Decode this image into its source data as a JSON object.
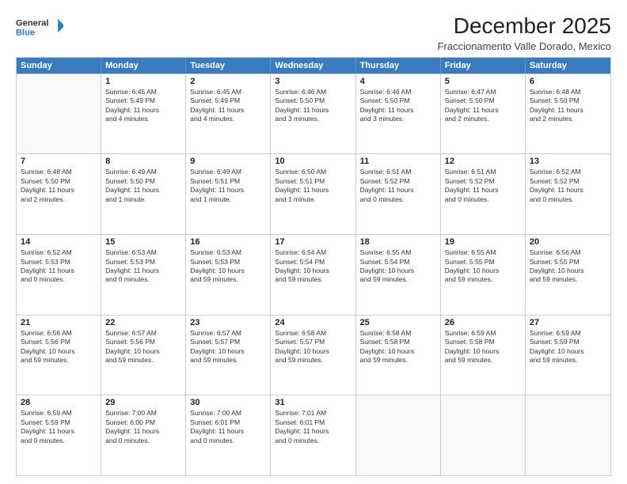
{
  "logo": {
    "line1": "General",
    "line2": "Blue"
  },
  "title": "December 2025",
  "subtitle": "Fraccionamento Valle Dorado, Mexico",
  "header": [
    "Sunday",
    "Monday",
    "Tuesday",
    "Wednesday",
    "Thursday",
    "Friday",
    "Saturday"
  ],
  "weeks": [
    [
      {
        "day": "",
        "info": ""
      },
      {
        "day": "1",
        "info": "Sunrise: 6:45 AM\nSunset: 5:49 PM\nDaylight: 11 hours\nand 4 minutes."
      },
      {
        "day": "2",
        "info": "Sunrise: 6:45 AM\nSunset: 5:49 PM\nDaylight: 11 hours\nand 4 minutes."
      },
      {
        "day": "3",
        "info": "Sunrise: 6:46 AM\nSunset: 5:50 PM\nDaylight: 11 hours\nand 3 minutes."
      },
      {
        "day": "4",
        "info": "Sunrise: 6:46 AM\nSunset: 5:50 PM\nDaylight: 11 hours\nand 3 minutes."
      },
      {
        "day": "5",
        "info": "Sunrise: 6:47 AM\nSunset: 5:50 PM\nDaylight: 11 hours\nand 2 minutes."
      },
      {
        "day": "6",
        "info": "Sunrise: 6:48 AM\nSunset: 5:50 PM\nDaylight: 11 hours\nand 2 minutes."
      }
    ],
    [
      {
        "day": "7",
        "info": "Sunrise: 6:48 AM\nSunset: 5:50 PM\nDaylight: 11 hours\nand 2 minutes."
      },
      {
        "day": "8",
        "info": "Sunrise: 6:49 AM\nSunset: 5:50 PM\nDaylight: 11 hours\nand 1 minute."
      },
      {
        "day": "9",
        "info": "Sunrise: 6:49 AM\nSunset: 5:51 PM\nDaylight: 11 hours\nand 1 minute."
      },
      {
        "day": "10",
        "info": "Sunrise: 6:50 AM\nSunset: 5:51 PM\nDaylight: 11 hours\nand 1 minute."
      },
      {
        "day": "11",
        "info": "Sunrise: 6:51 AM\nSunset: 5:52 PM\nDaylight: 11 hours\nand 0 minutes."
      },
      {
        "day": "12",
        "info": "Sunrise: 6:51 AM\nSunset: 5:52 PM\nDaylight: 11 hours\nand 0 minutes."
      },
      {
        "day": "13",
        "info": "Sunrise: 6:52 AM\nSunset: 5:52 PM\nDaylight: 11 hours\nand 0 minutes."
      }
    ],
    [
      {
        "day": "14",
        "info": "Sunrise: 6:52 AM\nSunset: 5:53 PM\nDaylight: 11 hours\nand 0 minutes."
      },
      {
        "day": "15",
        "info": "Sunrise: 6:53 AM\nSunset: 5:53 PM\nDaylight: 11 hours\nand 0 minutes."
      },
      {
        "day": "16",
        "info": "Sunrise: 6:53 AM\nSunset: 5:53 PM\nDaylight: 10 hours\nand 59 minutes."
      },
      {
        "day": "17",
        "info": "Sunrise: 6:54 AM\nSunset: 5:54 PM\nDaylight: 10 hours\nand 59 minutes."
      },
      {
        "day": "18",
        "info": "Sunrise: 6:55 AM\nSunset: 5:54 PM\nDaylight: 10 hours\nand 59 minutes."
      },
      {
        "day": "19",
        "info": "Sunrise: 6:55 AM\nSunset: 5:55 PM\nDaylight: 10 hours\nand 59 minutes."
      },
      {
        "day": "20",
        "info": "Sunrise: 6:56 AM\nSunset: 5:55 PM\nDaylight: 10 hours\nand 59 minutes."
      }
    ],
    [
      {
        "day": "21",
        "info": "Sunrise: 6:56 AM\nSunset: 5:56 PM\nDaylight: 10 hours\nand 59 minutes."
      },
      {
        "day": "22",
        "info": "Sunrise: 6:57 AM\nSunset: 5:56 PM\nDaylight: 10 hours\nand 59 minutes."
      },
      {
        "day": "23",
        "info": "Sunrise: 6:57 AM\nSunset: 5:57 PM\nDaylight: 10 hours\nand 59 minutes."
      },
      {
        "day": "24",
        "info": "Sunrise: 6:58 AM\nSunset: 5:57 PM\nDaylight: 10 hours\nand 59 minutes."
      },
      {
        "day": "25",
        "info": "Sunrise: 6:58 AM\nSunset: 5:58 PM\nDaylight: 10 hours\nand 59 minutes."
      },
      {
        "day": "26",
        "info": "Sunrise: 6:59 AM\nSunset: 5:58 PM\nDaylight: 10 hours\nand 59 minutes."
      },
      {
        "day": "27",
        "info": "Sunrise: 6:59 AM\nSunset: 5:59 PM\nDaylight: 10 hours\nand 59 minutes."
      }
    ],
    [
      {
        "day": "28",
        "info": "Sunrise: 6:59 AM\nSunset: 5:59 PM\nDaylight: 11 hours\nand 0 minutes."
      },
      {
        "day": "29",
        "info": "Sunrise: 7:00 AM\nSunset: 6:00 PM\nDaylight: 11 hours\nand 0 minutes."
      },
      {
        "day": "30",
        "info": "Sunrise: 7:00 AM\nSunset: 6:01 PM\nDaylight: 11 hours\nand 0 minutes."
      },
      {
        "day": "31",
        "info": "Sunrise: 7:01 AM\nSunset: 6:01 PM\nDaylight: 11 hours\nand 0 minutes."
      },
      {
        "day": "",
        "info": ""
      },
      {
        "day": "",
        "info": ""
      },
      {
        "day": "",
        "info": ""
      }
    ]
  ]
}
